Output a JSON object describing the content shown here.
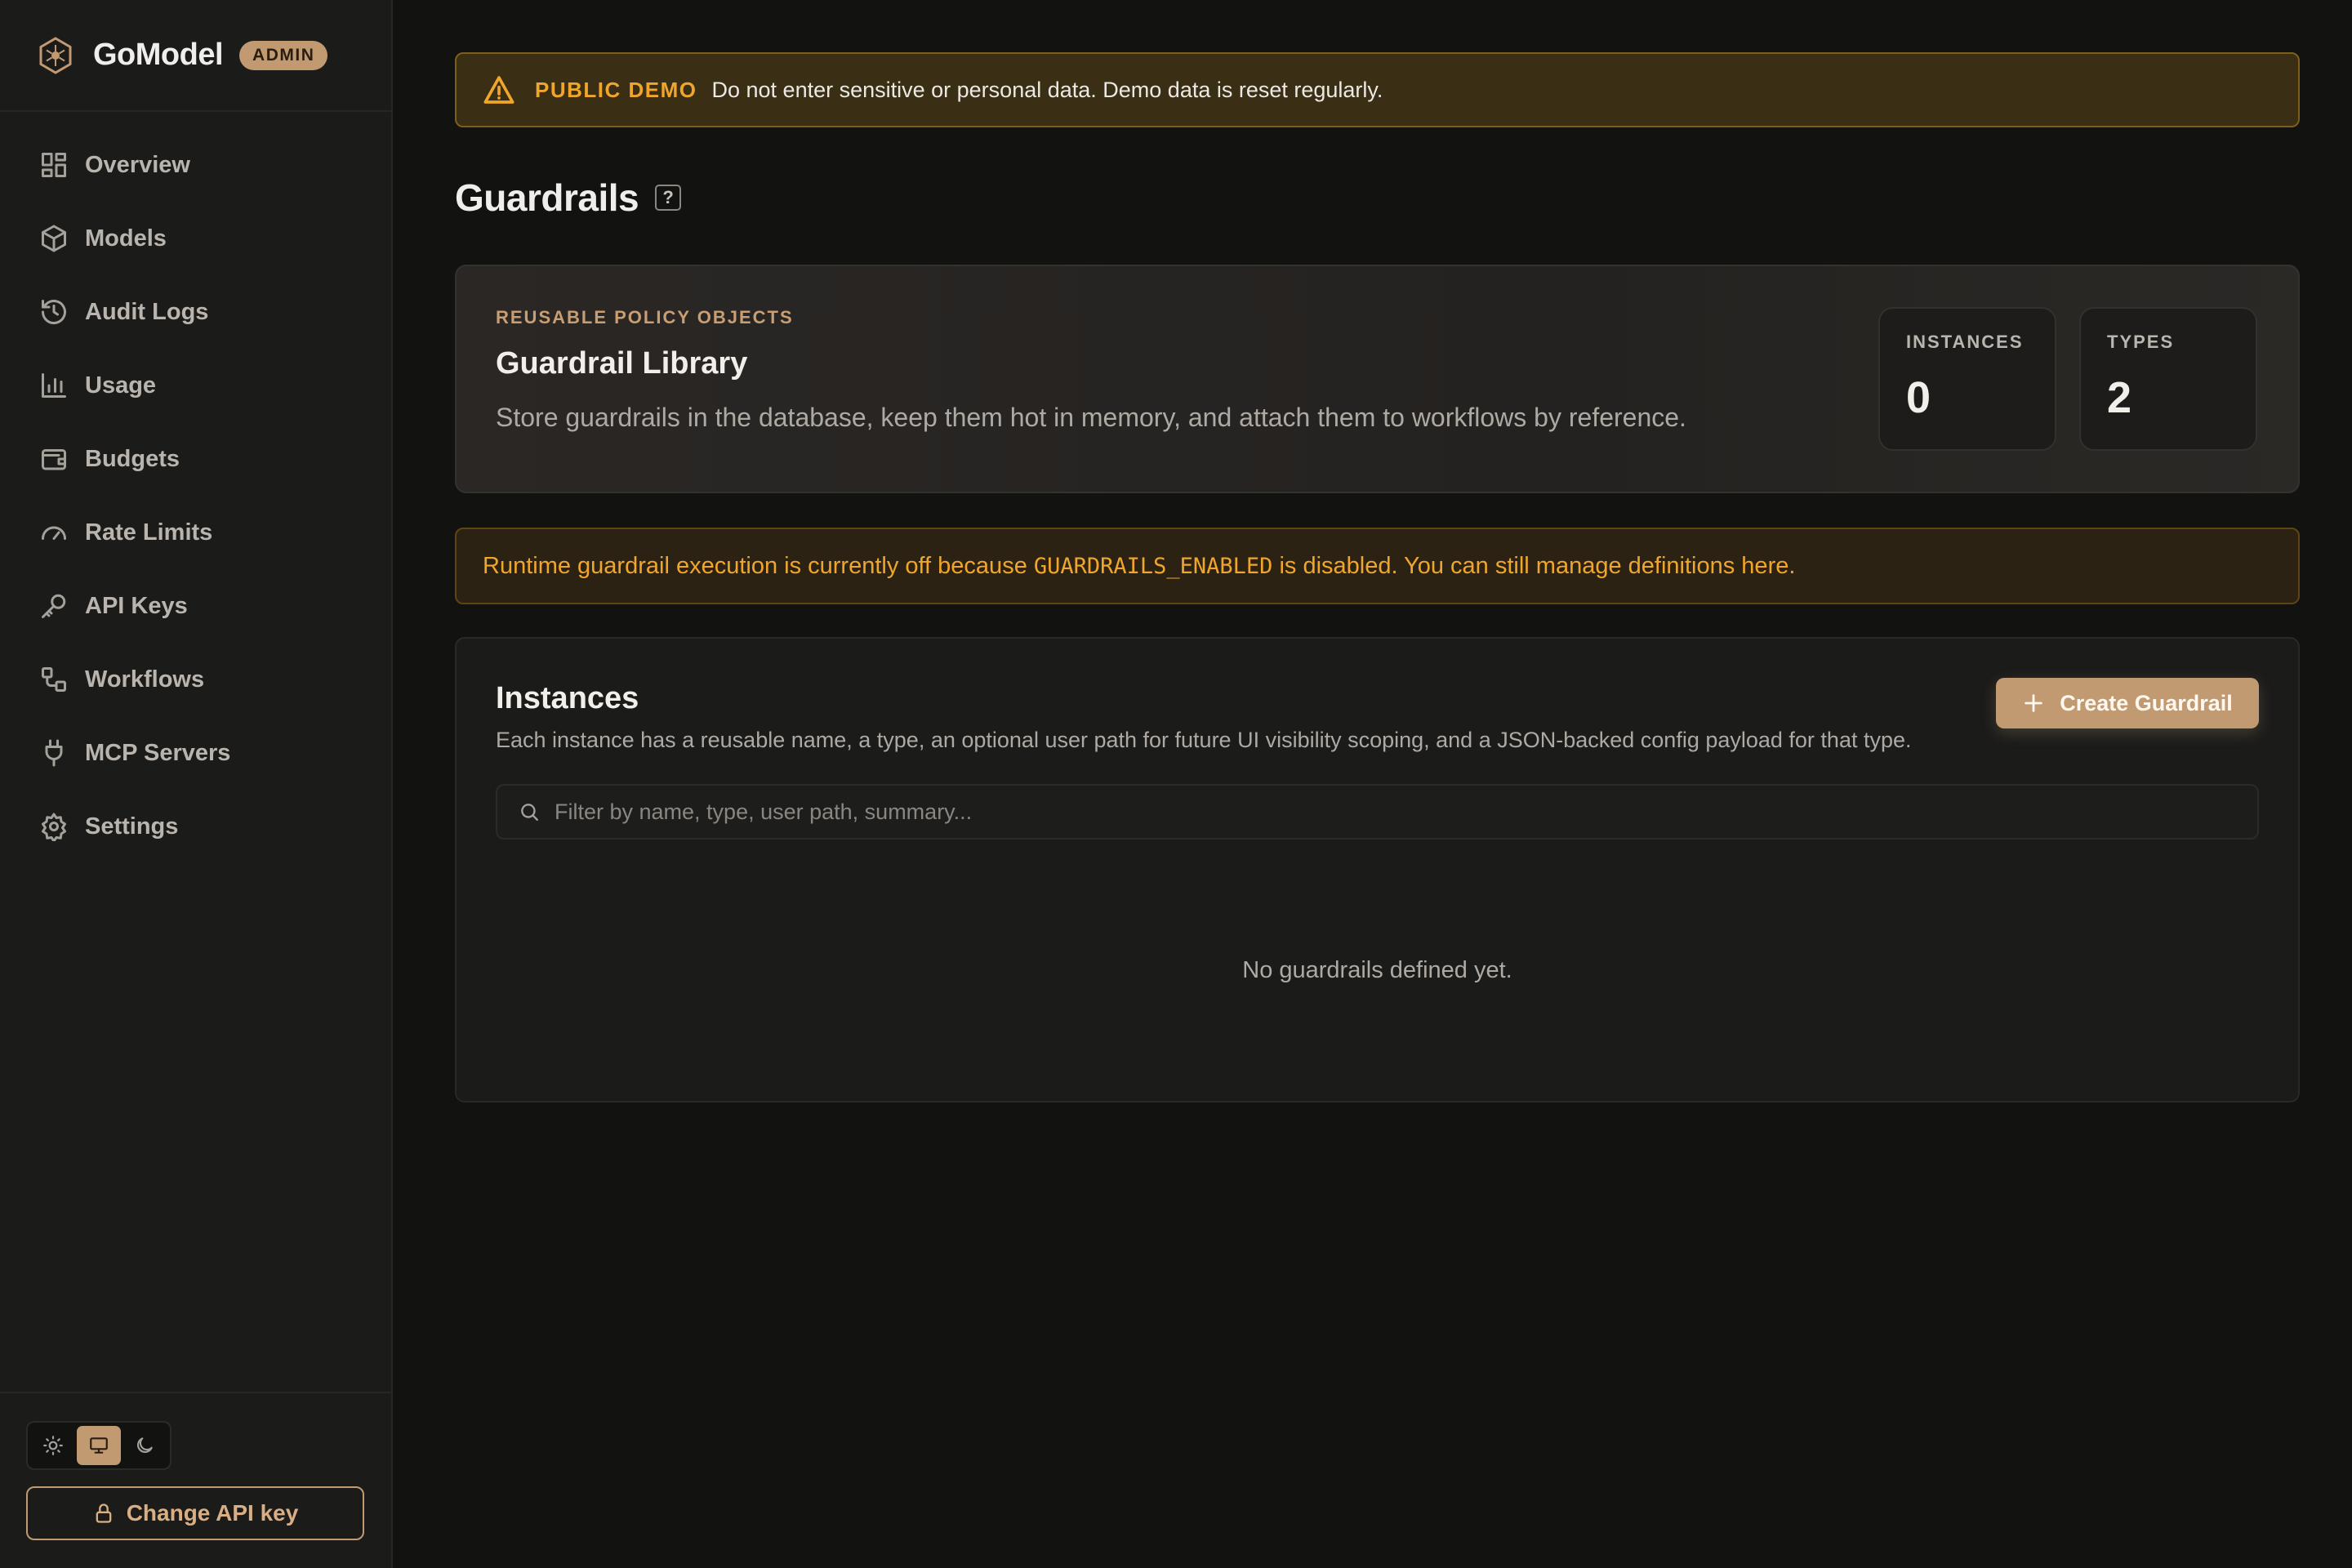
{
  "brand": {
    "name": "GoModel",
    "badge": "ADMIN"
  },
  "sidebar": {
    "items": [
      {
        "label": "Overview",
        "icon": "grid-icon"
      },
      {
        "label": "Models",
        "icon": "cube-icon"
      },
      {
        "label": "Audit Logs",
        "icon": "history-icon"
      },
      {
        "label": "Usage",
        "icon": "bar-chart-icon"
      },
      {
        "label": "Budgets",
        "icon": "wallet-icon"
      },
      {
        "label": "Rate Limits",
        "icon": "gauge-icon"
      },
      {
        "label": "API Keys",
        "icon": "key-icon"
      },
      {
        "label": "Workflows",
        "icon": "workflow-icon"
      },
      {
        "label": "MCP Servers",
        "icon": "plug-icon"
      },
      {
        "label": "Settings",
        "icon": "gear-icon"
      }
    ],
    "theme": {
      "options": [
        "light",
        "system",
        "dark"
      ],
      "selected": "system"
    },
    "change_key_label": "Change API key"
  },
  "demo_banner": {
    "tag": "PUBLIC DEMO",
    "text": "Do not enter sensitive or personal data. Demo data is reset regularly."
  },
  "page": {
    "title": "Guardrails",
    "help": "?"
  },
  "library": {
    "eyebrow": "REUSABLE POLICY OBJECTS",
    "title": "Guardrail Library",
    "description": "Store guardrails in the database, keep them hot in memory, and attach them to workflows by reference.",
    "stats": [
      {
        "label": "INSTANCES",
        "value": "0"
      },
      {
        "label": "TYPES",
        "value": "2"
      }
    ]
  },
  "runtime_notice": {
    "before": "Runtime guardrail execution is currently off because",
    "code": "GUARDRAILS_ENABLED",
    "after": "is disabled. You can still manage definitions here."
  },
  "instances": {
    "title": "Instances",
    "description": "Each instance has a reusable name, a type, an optional user path for future UI visibility scoping, and a JSON-backed config payload for that type.",
    "create_label": "Create Guardrail",
    "filter_placeholder": "Filter by name, type, user path, summary...",
    "filter_value": "",
    "empty_text": "No guardrails defined yet."
  },
  "colors": {
    "accent": "#c19a72",
    "warning": "#f0a62b",
    "background": "#121211",
    "sidebar": "#1b1b1a"
  }
}
